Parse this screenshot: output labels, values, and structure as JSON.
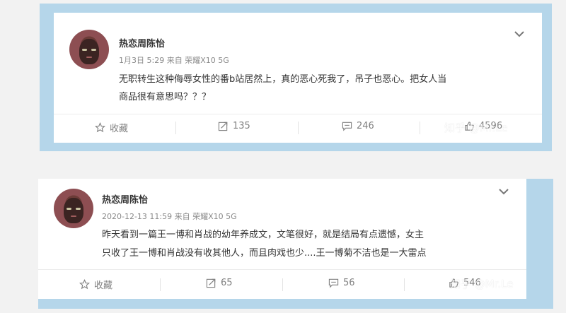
{
  "posts": [
    {
      "username": "热恋周陈怡",
      "meta": "1月3日 5:29 来自 荣耀X10 5G",
      "lines": [
        "无职转生这种侮辱女性的番b站居然上，真的恶心死我了，吊子也恶心。把女人当",
        "商品很有意思吗？？？"
      ],
      "actions": {
        "favorite": "收藏",
        "repost": "135",
        "comment": "246",
        "like": "4596"
      }
    },
    {
      "username": "热恋周陈怡",
      "meta": "2020-12-13 11:59 来自 荣耀X10 5G",
      "lines": [
        "昨天看到一篇王一博和肖战的幼年养成文，文笔很好，就是结局有点遗憾，女主",
        "只收了王一博和肖战没有收其他人，而且肉戏也少....王一博菊不洁也是一大雷点"
      ],
      "actions": {
        "favorite": "收藏",
        "repost": "65",
        "comment": "56",
        "like": "546"
      }
    }
  ],
  "watermark": "知乎 @Mr.Le",
  "colors": {
    "frame": "#b5d6ea",
    "text": "#333333",
    "meta": "#8a8a8a",
    "action": "#808080"
  }
}
